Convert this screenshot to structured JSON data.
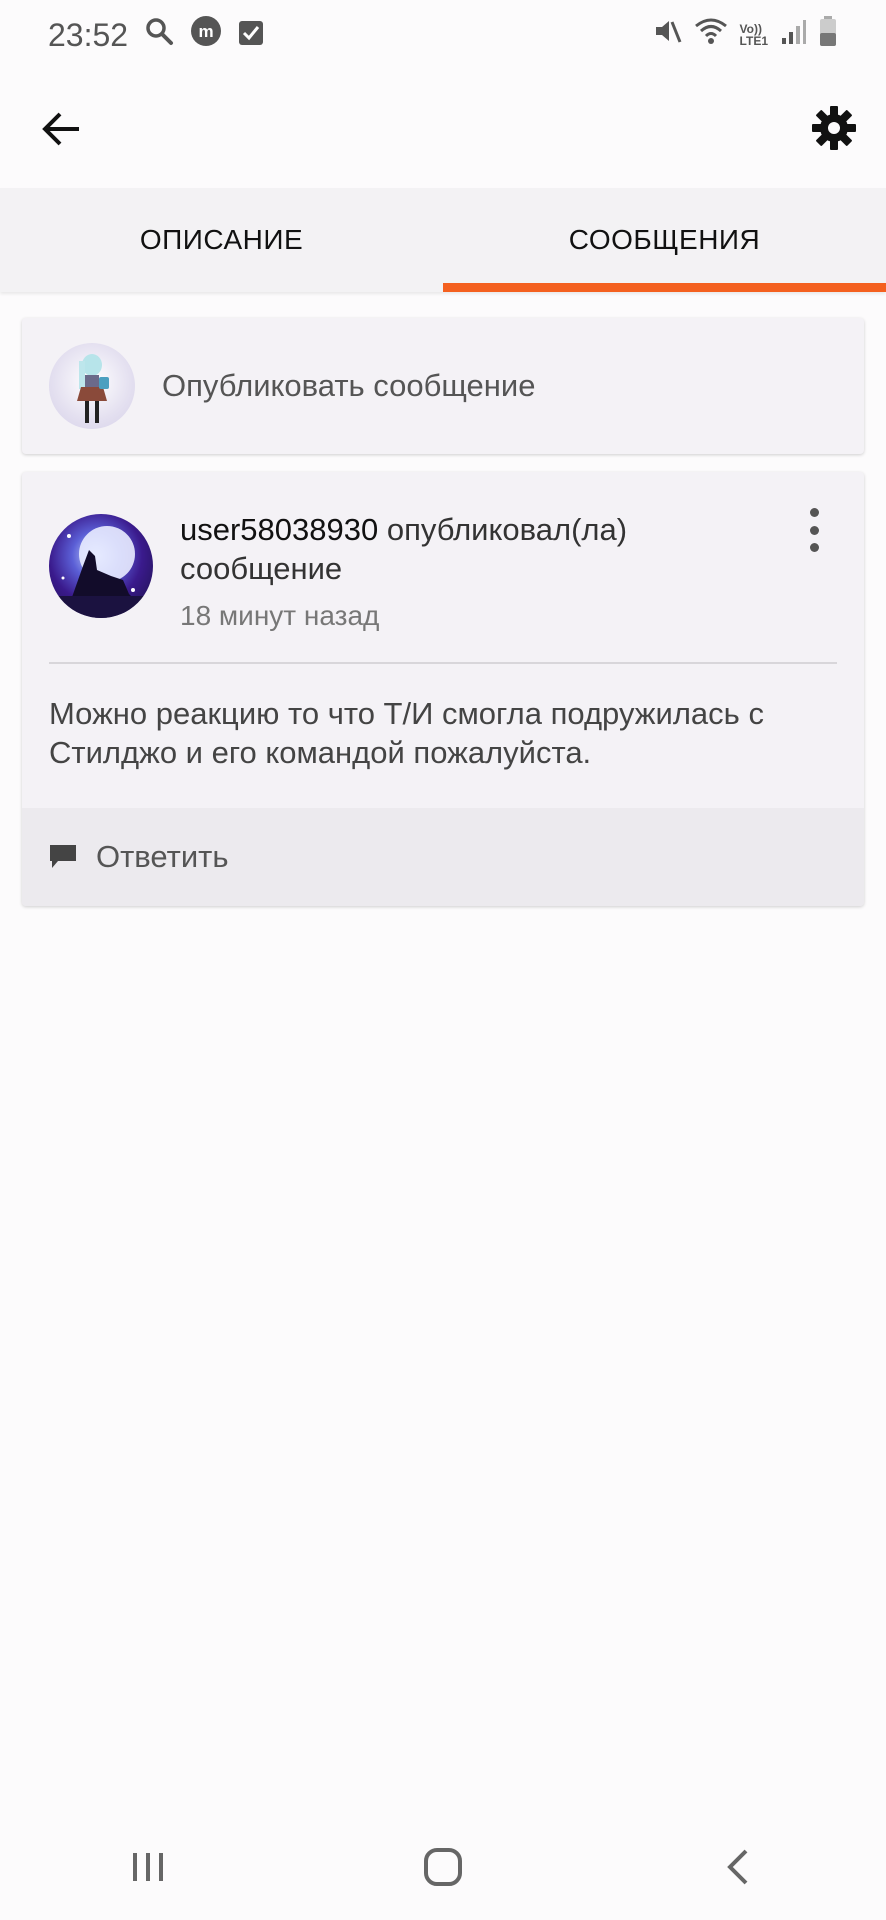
{
  "status_bar": {
    "time": "23:52",
    "icons_left": [
      "search-icon",
      "messenger-app-icon",
      "checkbox-icon"
    ],
    "icons_right": [
      "mute-icon",
      "wifi-icon",
      "volte-icon",
      "signal-icon",
      "battery-icon"
    ],
    "volte_label_top": "Vo))",
    "volte_label_bottom": "LTE1"
  },
  "app_bar": {
    "back_icon": "arrow-left-icon",
    "settings_icon": "gear-icon"
  },
  "tabs": [
    {
      "label": "ОПИСАНИЕ",
      "active": false
    },
    {
      "label": "СООБЩЕНИЯ",
      "active": true
    }
  ],
  "compose": {
    "placeholder": "Опубликовать сообщение"
  },
  "post": {
    "username": "user58038930",
    "action": " опубликовал(ла) сообщение",
    "time": "18 минут назад",
    "body": "Можно реакцию то что Т/И смогла подружилась с Стилджо и его командой пожалуйста.",
    "reply_label": "Ответить"
  },
  "colors": {
    "accent": "#f4601f",
    "background": "#fcfbfc",
    "card": "#f4f2f6"
  }
}
